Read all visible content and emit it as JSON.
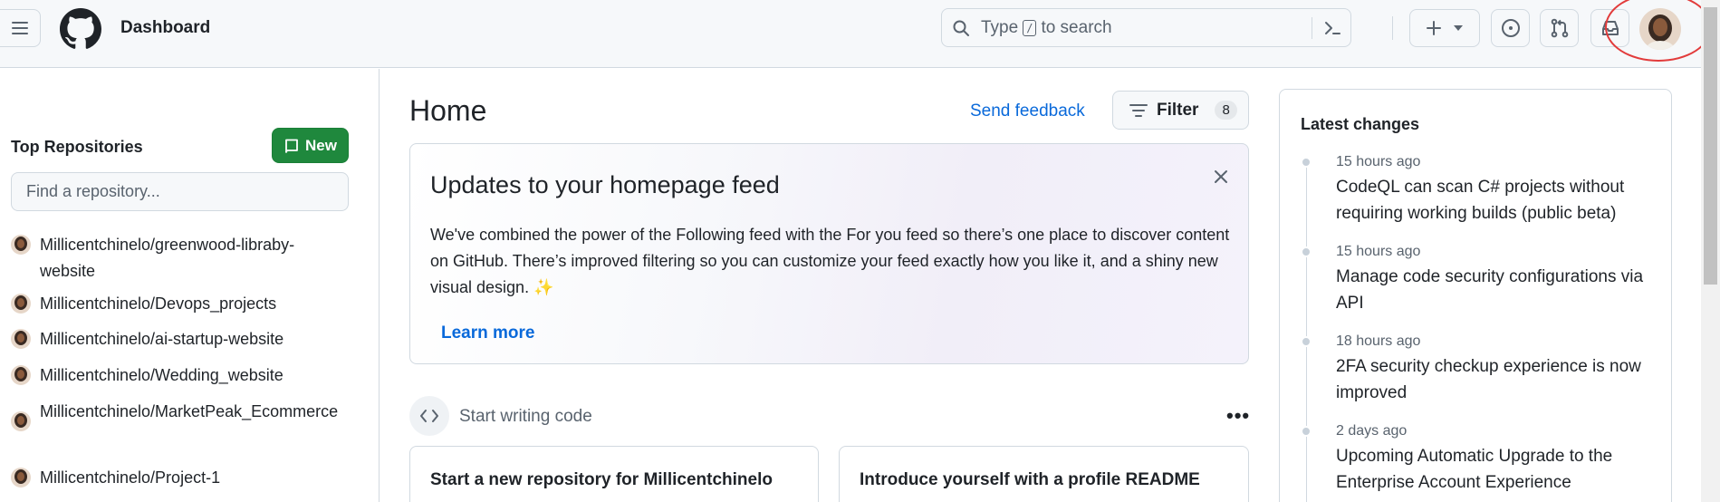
{
  "header": {
    "title": "Dashboard",
    "search_placeholder_before": "Type",
    "search_key": "/",
    "search_placeholder_after": "to search"
  },
  "sidebar": {
    "title": "Top Repositories",
    "new_label": "New",
    "find_placeholder": "Find a repository...",
    "repos": [
      "Millicentchinelo/greenwood-libraby-website",
      "Millicentchinelo/Devops_projects",
      "Millicentchinelo/ai-startup-website",
      "Millicentchinelo/Wedding_website",
      "Millicentchinelo/MarketPeak_Ecommerce",
      "Millicentchinelo/Project-1"
    ]
  },
  "main": {
    "title": "Home",
    "send_feedback": "Send feedback",
    "filter_label": "Filter",
    "filter_count": "8",
    "updates": {
      "title": "Updates to your homepage feed",
      "body": "We've combined the power of the Following feed with the For you feed so there’s one place to discover content on GitHub. There’s improved filtering so you can customize your feed exactly how you like it, and a shiny new visual design. ✨",
      "learn_more": "Learn more"
    },
    "start_writing": "Start writing code",
    "card1": "Start a new repository for Millicentchinelo",
    "card2": "Introduce yourself with a profile README"
  },
  "latest_changes": {
    "title": "Latest changes",
    "items": [
      {
        "when": "15 hours ago",
        "what": "CodeQL can scan C# projects without requiring working builds (public beta)"
      },
      {
        "when": "15 hours ago",
        "what": "Manage code security configurations via API"
      },
      {
        "when": "18 hours ago",
        "what": "2FA security checkup experience is now improved"
      },
      {
        "when": "2 days ago",
        "what": "Upcoming Automatic Upgrade to the Enterprise Account Experience"
      }
    ]
  },
  "colors": {
    "accent_link": "#0969da",
    "new_button": "#1f883d",
    "highlight_ring": "#e23b3b"
  },
  "icons": [
    "hamburger-icon",
    "github-logo",
    "search-icon",
    "command-palette-icon",
    "plus-icon",
    "chevron-down-icon",
    "issue-icon",
    "pull-request-icon",
    "inbox-icon",
    "repo-icon",
    "filter-icon",
    "close-icon",
    "code-icon",
    "kebab-icon"
  ]
}
